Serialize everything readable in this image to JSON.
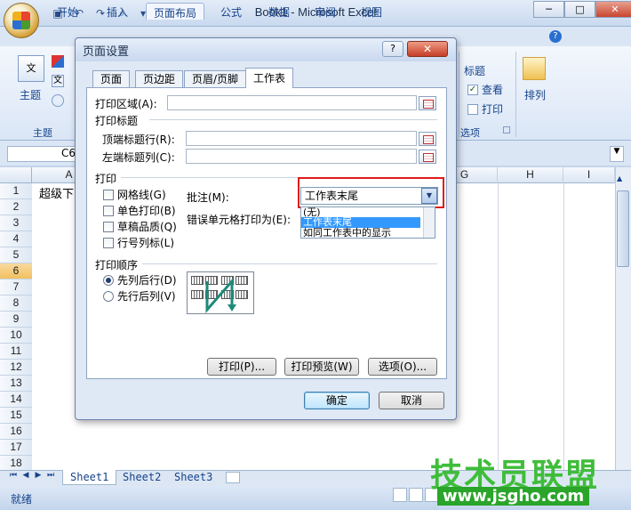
{
  "app": {
    "title": "Book1 - Microsoft Excel",
    "tabs": [
      "开始",
      "插入",
      "页面布局",
      "公式",
      "数据",
      "审阅",
      "视图"
    ],
    "minimize": "─",
    "restore": "□",
    "close": "✕"
  },
  "ribbon": {
    "theme_icon_text": "文",
    "theme_label": "主题",
    "theme_group": "主题",
    "sheet_options_heading": "标题",
    "view_label": "查看",
    "print_label": "打印",
    "options_group": "选项",
    "arrange_label": "排列"
  },
  "formula_bar": {
    "name_box": "C6"
  },
  "sheet": {
    "columns": [
      "A",
      "G",
      "H",
      "I"
    ],
    "rows": [
      "1",
      "2",
      "3",
      "4",
      "5",
      "6",
      "7",
      "8",
      "9",
      "10",
      "11",
      "12",
      "13",
      "14",
      "15",
      "16",
      "17",
      "18"
    ],
    "selected_row": "6",
    "a1_text": "超级下"
  },
  "sheet_tabs": [
    "Sheet1",
    "Sheet2",
    "Sheet3"
  ],
  "status": {
    "ready": "就绪"
  },
  "watermark": {
    "text": "技术员联盟",
    "url": "www.jsgho.com"
  },
  "dialog": {
    "title": "页面设置",
    "help": "?",
    "close": "✕",
    "tabs": [
      "页面",
      "页边距",
      "页眉/页脚",
      "工作表"
    ],
    "active_tab": "工作表",
    "print_area_label": "打印区域(A):",
    "print_titles_heading": "打印标题",
    "top_rows_label": "顶端标题行(R):",
    "left_cols_label": "左端标题列(C):",
    "print_heading": "打印",
    "checkboxes": [
      "网格线(G)",
      "单色打印(B)",
      "草稿品质(Q)",
      "行号列标(L)"
    ],
    "comments_label": "批注(M):",
    "comments_value": "工作表末尾",
    "errors_label": "错误单元格打印为(E):",
    "comments_options": [
      "(无)",
      "工作表末尾",
      "如同工作表中的显示"
    ],
    "order_heading": "打印顺序",
    "order_options": [
      "先列后行(D)",
      "先行后列(V)"
    ],
    "order_selected": "先列后行(D)",
    "print_button": "打印(P)...",
    "preview_button": "打印预览(W)",
    "options_button": "选项(O)...",
    "ok_button": "确定",
    "cancel_button": "取消"
  },
  "colors": {
    "highlight": "#e01b1b",
    "dropdown_selected": "#3399ff"
  }
}
